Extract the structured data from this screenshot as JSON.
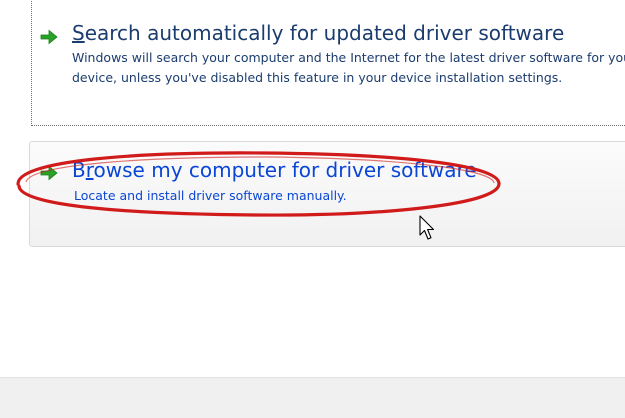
{
  "options": {
    "auto": {
      "title_accel": "S",
      "title_rest": "earch automatically for updated driver software",
      "description": "Windows will search your computer and the Internet for the latest driver software for your device, unless you've disabled this feature in your device installation settings."
    },
    "browse": {
      "title_pre": "B",
      "title_accel": "r",
      "title_rest": "owse my computer for driver software",
      "description": "Locate and install driver software manually."
    }
  },
  "icons": {
    "option_arrow": "green-arrow-icon",
    "mouse_cursor": "cursor-arrow-icon"
  },
  "colors": {
    "arrow_green": "#27a327",
    "link_blue": "#0a46d6",
    "heading_navy": "#1b3c6f",
    "annotation_red": "#d11b1b"
  }
}
